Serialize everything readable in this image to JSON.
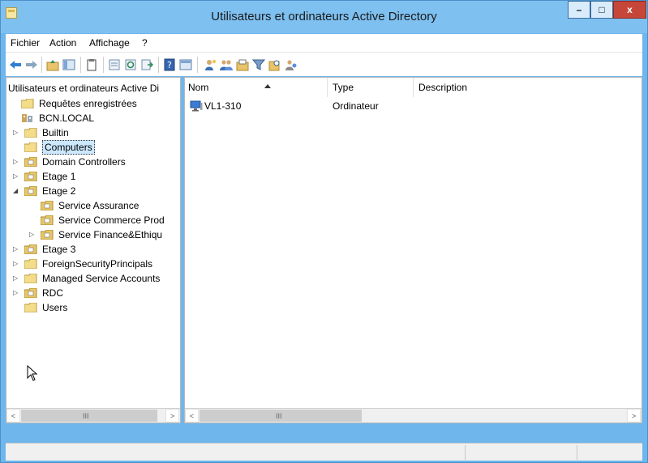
{
  "window": {
    "title": "Utilisateurs et ordinateurs Active Directory",
    "controls": {
      "minimize": "–",
      "maximize": "□",
      "close": "x"
    }
  },
  "menu": [
    {
      "label": "Fichier"
    },
    {
      "label": "Action"
    },
    {
      "label": "Affichage"
    },
    {
      "label": "?"
    }
  ],
  "toolbar": {
    "icons": [
      "back-arrow-icon",
      "forward-arrow-icon",
      "up-folder-icon",
      "show-tree-icon",
      "clipboard-icon",
      "properties-icon",
      "refresh-icon",
      "export-list-icon",
      "help-icon",
      "console-icon",
      "new-user-icon",
      "new-group-icon",
      "new-ou-icon",
      "filter-icon",
      "find-icon",
      "delegate-icon"
    ]
  },
  "tree": {
    "root_label": "Utilisateurs et ordinateurs Active Di",
    "items": [
      {
        "label": "Requêtes enregistrées",
        "expander": "",
        "type": "folder"
      },
      {
        "label": "BCN.LOCAL",
        "expander": "",
        "type": "domain"
      },
      {
        "label": "Builtin",
        "expander": "▷",
        "type": "folder"
      },
      {
        "label": "Computers",
        "expander": "",
        "type": "folder",
        "selected": true
      },
      {
        "label": "Domain Controllers",
        "expander": "▷",
        "type": "ou"
      },
      {
        "label": "Etage 1",
        "expander": "▷",
        "type": "ou"
      },
      {
        "label": "Etage 2",
        "expander": "◢",
        "type": "ou"
      },
      {
        "label": "Service Assurance",
        "expander": "",
        "type": "ou"
      },
      {
        "label": "Service Commerce Prod",
        "expander": "",
        "type": "ou"
      },
      {
        "label": "Service Finance&Ethiqu",
        "expander": "▷",
        "type": "ou"
      },
      {
        "label": "Etage 3",
        "expander": "▷",
        "type": "ou"
      },
      {
        "label": "ForeignSecurityPrincipals",
        "expander": "▷",
        "type": "folder"
      },
      {
        "label": "Managed Service Accounts",
        "expander": "▷",
        "type": "folder"
      },
      {
        "label": "RDC",
        "expander": "▷",
        "type": "ou"
      },
      {
        "label": "Users",
        "expander": "",
        "type": "folder"
      }
    ]
  },
  "list": {
    "columns": [
      {
        "label": "Nom"
      },
      {
        "label": "Type"
      },
      {
        "label": "Description"
      }
    ],
    "rows": [
      {
        "name": "VL1-310",
        "type": "Ordinateur",
        "description": ""
      }
    ]
  },
  "scroll": {
    "left_arrow": "<",
    "right_arrow": ">",
    "grip": "III"
  },
  "colors": {
    "titlebar": "#7ec0f0",
    "close_button": "#c7463a",
    "selection": "#cce8ff"
  }
}
